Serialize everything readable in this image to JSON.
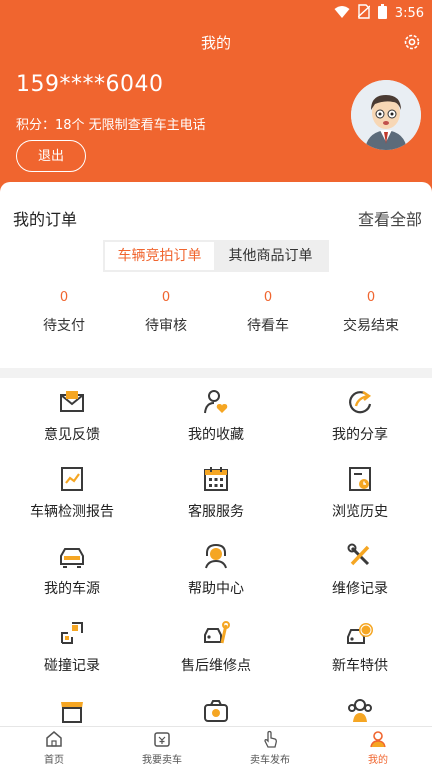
{
  "status_bar": {
    "time": "3:56"
  },
  "header": {
    "title": "我的",
    "phone": "159****6040",
    "points_text": "积分：18个 无限制查看车主电话",
    "logout_label": "退出"
  },
  "orders": {
    "title": "我的订单",
    "view_all": "查看全部",
    "tabs": [
      {
        "label": "车辆竞拍订单",
        "active": true
      },
      {
        "label": "其他商品订单",
        "active": false
      }
    ],
    "statuses": [
      {
        "count": "0",
        "label": "待支付"
      },
      {
        "count": "0",
        "label": "待审核"
      },
      {
        "count": "0",
        "label": "待看车"
      },
      {
        "count": "0",
        "label": "交易结束"
      }
    ]
  },
  "menu": [
    {
      "label": "意见反馈",
      "icon": "feedback-envelope-icon"
    },
    {
      "label": "我的收藏",
      "icon": "favorite-person-icon"
    },
    {
      "label": "我的分享",
      "icon": "share-arrow-icon"
    },
    {
      "label": "车辆检测报告",
      "icon": "inspection-report-icon"
    },
    {
      "label": "客服服务",
      "icon": "calendar-service-icon"
    },
    {
      "label": "浏览历史",
      "icon": "history-clock-icon"
    },
    {
      "label": "我的车源",
      "icon": "car-source-icon"
    },
    {
      "label": "帮助中心",
      "icon": "headset-help-icon"
    },
    {
      "label": "维修记录",
      "icon": "tools-icon"
    },
    {
      "label": "碰撞记录",
      "icon": "collision-icon"
    },
    {
      "label": "售后维修点",
      "icon": "repair-car-wrench-icon"
    },
    {
      "label": "新车特供",
      "icon": "new-car-icon"
    },
    {
      "label": "",
      "icon": "store-icon"
    },
    {
      "label": "",
      "icon": "camera-icon"
    },
    {
      "label": "",
      "icon": "group-icon"
    }
  ],
  "tabbar": [
    {
      "label": "首页",
      "icon": "home-icon",
      "active": false
    },
    {
      "label": "我要卖车",
      "icon": "sell-car-icon",
      "active": false
    },
    {
      "label": "卖车发布",
      "icon": "tap-hand-icon",
      "active": false
    },
    {
      "label": "我的",
      "icon": "profile-icon",
      "active": true
    }
  ],
  "colors": {
    "accent": "#f0652f",
    "icon_dark": "#3a3a3a",
    "icon_accent": "#f5a623"
  }
}
